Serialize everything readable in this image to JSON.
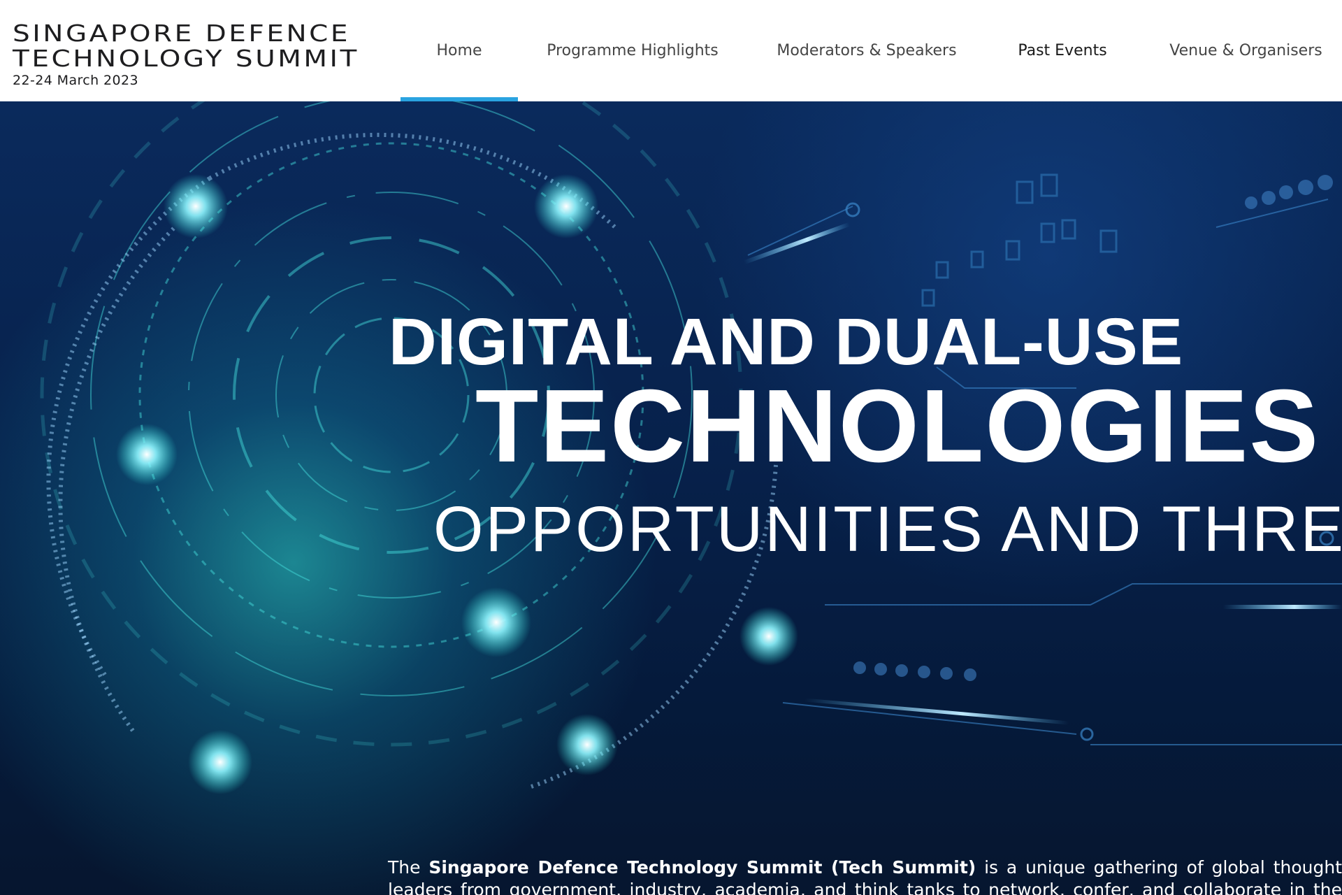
{
  "brand": {
    "line1": "Singapore Defence",
    "line2": "Technology Summit",
    "date": "22-24 March 2023"
  },
  "nav": {
    "items": [
      {
        "label": "Home"
      },
      {
        "label": "Programme Highlights"
      },
      {
        "label": "Moderators & Speakers"
      },
      {
        "label": "Past Events"
      },
      {
        "label": "Venue & Organisers"
      }
    ],
    "active_index": 0
  },
  "hero": {
    "headline_1": "DIGITAL AND DUAL-USE",
    "headline_2": "TECHNOLOGIES",
    "headline_3": "OPPORTUNITIES AND THREATS",
    "intro_prefix": "The",
    "intro_bold": "Singapore Defence Technology Summit (Tech Summit)",
    "intro_rest": "is a unique gathering of global thought leaders from government, industry, academia, and think tanks to network, confer, and collaborate in the development of defence and"
  },
  "colors": {
    "accent": "#2aa3e0",
    "hero_bg": "#07214b",
    "glow": "#2ee6dc"
  }
}
